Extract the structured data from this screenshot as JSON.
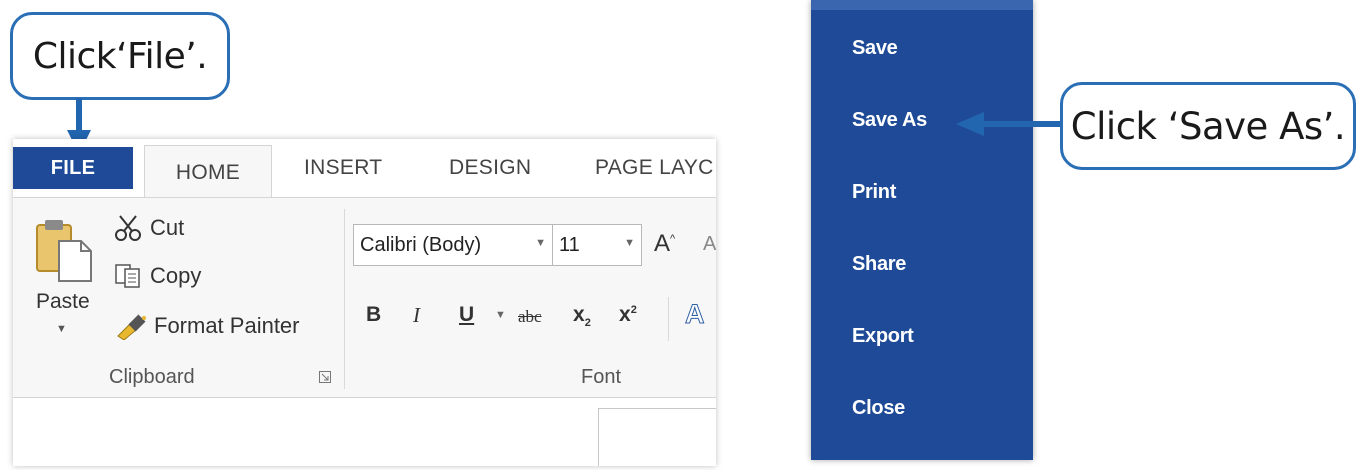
{
  "callouts": {
    "file": "Click‘File’.",
    "save_as": "Click ‘Save As’."
  },
  "ribbon": {
    "tabs": {
      "file": "FILE",
      "home": "HOME",
      "insert": "INSERT",
      "design": "DESIGN",
      "page_layout": "PAGE LAYC"
    },
    "clipboard": {
      "paste": "Paste",
      "cut": "Cut",
      "copy": "Copy",
      "format_painter": "Format Painter",
      "group_label": "Clipboard"
    },
    "font": {
      "font_name": "Calibri (Body)",
      "font_size": "11",
      "group_label": "Font",
      "bold": "B",
      "italic": "I",
      "underline": "U",
      "strikethrough": "abc",
      "subscript": "x",
      "superscript": "x",
      "grow": "A",
      "shrink": "A",
      "effects": "A"
    }
  },
  "file_menu": {
    "items": [
      "Save",
      "Save As",
      "Print",
      "Share",
      "Export",
      "Close"
    ]
  },
  "colors": {
    "accent": "#1e4a97",
    "callout_border": "#2a6fb5",
    "arrow": "#2266b0"
  },
  "icons": [
    "paste-icon",
    "scissors-icon",
    "copy-icon",
    "format-painter-icon",
    "dialog-launcher-icon",
    "dropdown-arrow-icon"
  ]
}
